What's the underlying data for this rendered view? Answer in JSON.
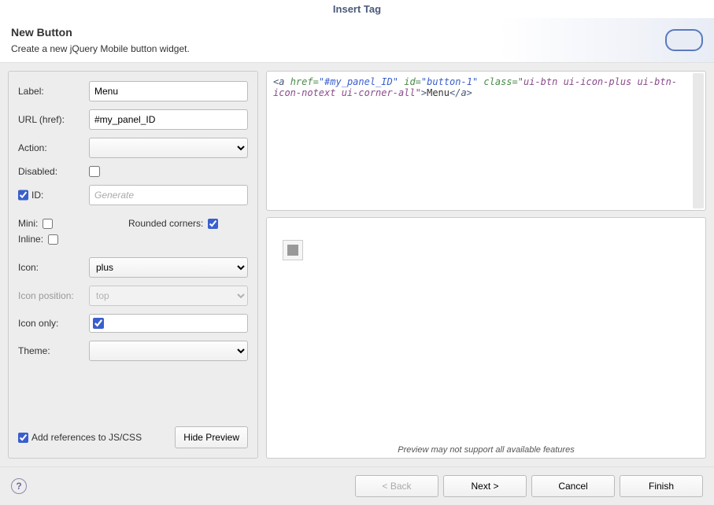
{
  "title": "Insert Tag",
  "header": {
    "heading": "New Button",
    "subheading": "Create a new jQuery Mobile button widget."
  },
  "form": {
    "label_label": "Label:",
    "label_value": "Menu",
    "url_label": "URL (href):",
    "url_value": "#my_panel_ID",
    "action_label": "Action:",
    "action_value": "",
    "disabled_label": "Disabled:",
    "disabled_checked": false,
    "id_label": "ID:",
    "id_checked": true,
    "id_placeholder": "Generate",
    "id_value": "",
    "mini_label": "Mini:",
    "mini_checked": false,
    "rounded_label": "Rounded corners:",
    "rounded_checked": true,
    "inline_label": "Inline:",
    "inline_checked": false,
    "icon_label": "Icon:",
    "icon_value": "plus",
    "iconpos_label": "Icon position:",
    "iconpos_value": "top",
    "icononly_label": "Icon only:",
    "icononly_checked": true,
    "theme_label": "Theme:",
    "theme_value": "",
    "addrefs_label": "Add references to JS/CSS",
    "addrefs_checked": true,
    "hidepreview_label": "Hide Preview"
  },
  "code": {
    "href": "#my_panel_ID",
    "id": "button-1",
    "cls": "ui-btn ui-icon-plus ui-btn-icon-notext ui-corner-all",
    "text": "Menu"
  },
  "preview_note": "Preview may not support all available features",
  "footer": {
    "back": "< Back",
    "next": "Next >",
    "cancel": "Cancel",
    "finish": "Finish"
  }
}
